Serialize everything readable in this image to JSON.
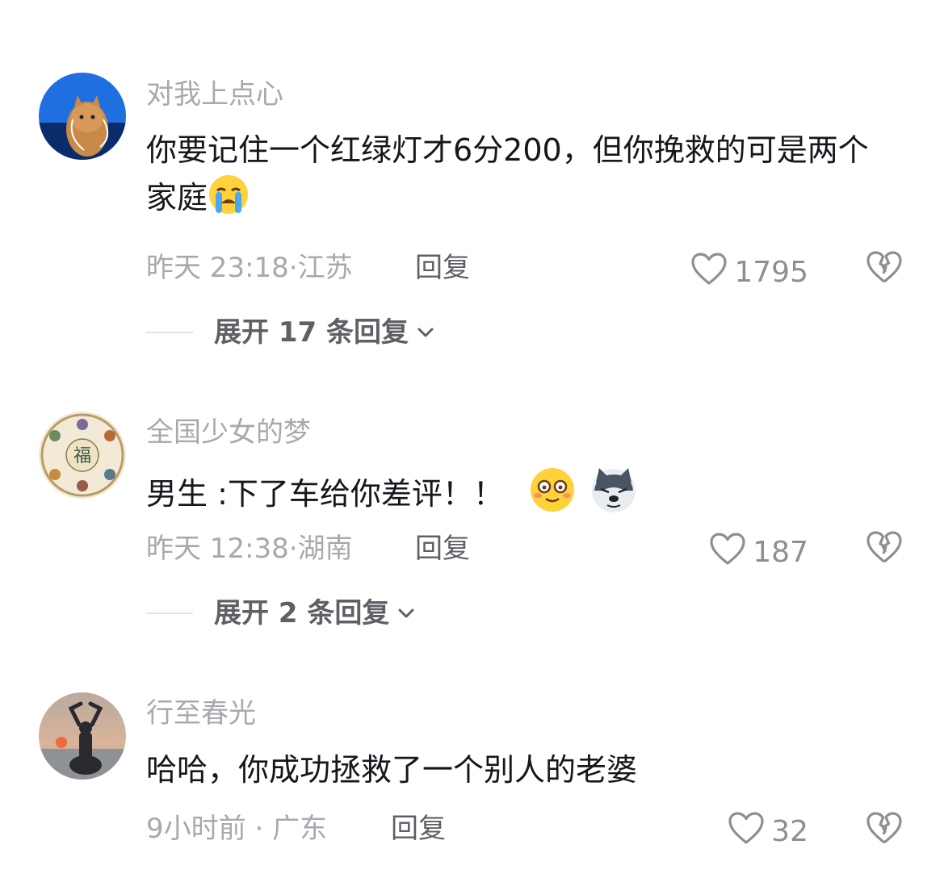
{
  "comments": [
    {
      "username": "对我上点心",
      "text": "你要记住一个红绿灯才6分200，但你挽救的可是两个家庭",
      "emojis": [
        "loudly-crying-face"
      ],
      "time": "昨天 23:18",
      "location": "江苏",
      "reply_label": "回复",
      "likes": "1795",
      "expand_label": "展开 17 条回复",
      "avatar": "cat-with-earphones"
    },
    {
      "username": "全国少女的梦",
      "text": "男生 :下了车给你差评！！",
      "emojis": [
        "blushing-smile-face",
        "husky-dog-face"
      ],
      "time": "昨天 12:38",
      "location": "湖南",
      "reply_label": "回复",
      "likes": "187",
      "expand_label": "展开 2 条回复",
      "avatar": "traditional-painting-plate"
    },
    {
      "username": "行至春光",
      "text": "哈哈，你成功拯救了一个别人的老婆",
      "emojis": [],
      "time": "9小时前",
      "location": "广东",
      "reply_label": "回复",
      "likes": "32",
      "avatar": "silhouette-sunset"
    }
  ],
  "colors": {
    "text": "#16171c",
    "muted": "#a8a9ae",
    "action": "#5f6066",
    "icon": "#8e8f95"
  },
  "icons": [
    "heart-outline-icon",
    "broken-heart-icon",
    "chevron-down-icon"
  ]
}
